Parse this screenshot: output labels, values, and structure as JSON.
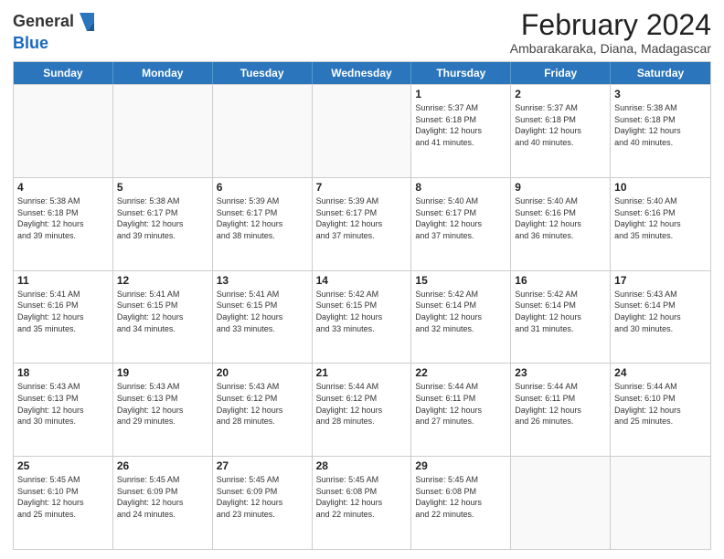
{
  "logo": {
    "general": "General",
    "blue": "Blue"
  },
  "title": "February 2024",
  "subtitle": "Ambarakaraka, Diana, Madagascar",
  "days": [
    "Sunday",
    "Monday",
    "Tuesday",
    "Wednesday",
    "Thursday",
    "Friday",
    "Saturday"
  ],
  "weeks": [
    [
      {
        "day": "",
        "info": ""
      },
      {
        "day": "",
        "info": ""
      },
      {
        "day": "",
        "info": ""
      },
      {
        "day": "",
        "info": ""
      },
      {
        "day": "1",
        "info": "Sunrise: 5:37 AM\nSunset: 6:18 PM\nDaylight: 12 hours\nand 41 minutes."
      },
      {
        "day": "2",
        "info": "Sunrise: 5:37 AM\nSunset: 6:18 PM\nDaylight: 12 hours\nand 40 minutes."
      },
      {
        "day": "3",
        "info": "Sunrise: 5:38 AM\nSunset: 6:18 PM\nDaylight: 12 hours\nand 40 minutes."
      }
    ],
    [
      {
        "day": "4",
        "info": "Sunrise: 5:38 AM\nSunset: 6:18 PM\nDaylight: 12 hours\nand 39 minutes."
      },
      {
        "day": "5",
        "info": "Sunrise: 5:38 AM\nSunset: 6:17 PM\nDaylight: 12 hours\nand 39 minutes."
      },
      {
        "day": "6",
        "info": "Sunrise: 5:39 AM\nSunset: 6:17 PM\nDaylight: 12 hours\nand 38 minutes."
      },
      {
        "day": "7",
        "info": "Sunrise: 5:39 AM\nSunset: 6:17 PM\nDaylight: 12 hours\nand 37 minutes."
      },
      {
        "day": "8",
        "info": "Sunrise: 5:40 AM\nSunset: 6:17 PM\nDaylight: 12 hours\nand 37 minutes."
      },
      {
        "day": "9",
        "info": "Sunrise: 5:40 AM\nSunset: 6:16 PM\nDaylight: 12 hours\nand 36 minutes."
      },
      {
        "day": "10",
        "info": "Sunrise: 5:40 AM\nSunset: 6:16 PM\nDaylight: 12 hours\nand 35 minutes."
      }
    ],
    [
      {
        "day": "11",
        "info": "Sunrise: 5:41 AM\nSunset: 6:16 PM\nDaylight: 12 hours\nand 35 minutes."
      },
      {
        "day": "12",
        "info": "Sunrise: 5:41 AM\nSunset: 6:15 PM\nDaylight: 12 hours\nand 34 minutes."
      },
      {
        "day": "13",
        "info": "Sunrise: 5:41 AM\nSunset: 6:15 PM\nDaylight: 12 hours\nand 33 minutes."
      },
      {
        "day": "14",
        "info": "Sunrise: 5:42 AM\nSunset: 6:15 PM\nDaylight: 12 hours\nand 33 minutes."
      },
      {
        "day": "15",
        "info": "Sunrise: 5:42 AM\nSunset: 6:14 PM\nDaylight: 12 hours\nand 32 minutes."
      },
      {
        "day": "16",
        "info": "Sunrise: 5:42 AM\nSunset: 6:14 PM\nDaylight: 12 hours\nand 31 minutes."
      },
      {
        "day": "17",
        "info": "Sunrise: 5:43 AM\nSunset: 6:14 PM\nDaylight: 12 hours\nand 30 minutes."
      }
    ],
    [
      {
        "day": "18",
        "info": "Sunrise: 5:43 AM\nSunset: 6:13 PM\nDaylight: 12 hours\nand 30 minutes."
      },
      {
        "day": "19",
        "info": "Sunrise: 5:43 AM\nSunset: 6:13 PM\nDaylight: 12 hours\nand 29 minutes."
      },
      {
        "day": "20",
        "info": "Sunrise: 5:43 AM\nSunset: 6:12 PM\nDaylight: 12 hours\nand 28 minutes."
      },
      {
        "day": "21",
        "info": "Sunrise: 5:44 AM\nSunset: 6:12 PM\nDaylight: 12 hours\nand 28 minutes."
      },
      {
        "day": "22",
        "info": "Sunrise: 5:44 AM\nSunset: 6:11 PM\nDaylight: 12 hours\nand 27 minutes."
      },
      {
        "day": "23",
        "info": "Sunrise: 5:44 AM\nSunset: 6:11 PM\nDaylight: 12 hours\nand 26 minutes."
      },
      {
        "day": "24",
        "info": "Sunrise: 5:44 AM\nSunset: 6:10 PM\nDaylight: 12 hours\nand 25 minutes."
      }
    ],
    [
      {
        "day": "25",
        "info": "Sunrise: 5:45 AM\nSunset: 6:10 PM\nDaylight: 12 hours\nand 25 minutes."
      },
      {
        "day": "26",
        "info": "Sunrise: 5:45 AM\nSunset: 6:09 PM\nDaylight: 12 hours\nand 24 minutes."
      },
      {
        "day": "27",
        "info": "Sunrise: 5:45 AM\nSunset: 6:09 PM\nDaylight: 12 hours\nand 23 minutes."
      },
      {
        "day": "28",
        "info": "Sunrise: 5:45 AM\nSunset: 6:08 PM\nDaylight: 12 hours\nand 22 minutes."
      },
      {
        "day": "29",
        "info": "Sunrise: 5:45 AM\nSunset: 6:08 PM\nDaylight: 12 hours\nand 22 minutes."
      },
      {
        "day": "",
        "info": ""
      },
      {
        "day": "",
        "info": ""
      }
    ]
  ]
}
